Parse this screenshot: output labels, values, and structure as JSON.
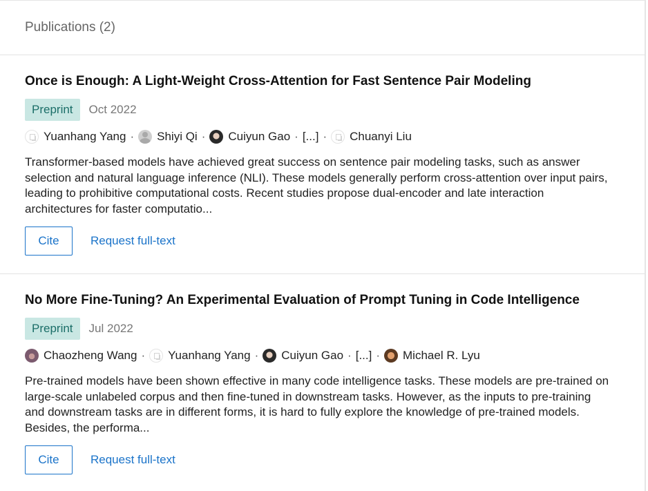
{
  "header": {
    "title": "Publications (2)"
  },
  "publications": [
    {
      "title": "Once is Enough: A Light-Weight Cross-Attention for Fast Sentence Pair Modeling",
      "type": "Preprint",
      "date": "Oct 2022",
      "authors": [
        {
          "name": "Yuanhang Yang",
          "avatar": "placeholder-avatar-icon"
        },
        {
          "name": "Shiyi Qi",
          "avatar": "generic-person-avatar-icon"
        },
        {
          "name": "Cuiyun Gao",
          "avatar": "photo-avatar"
        },
        {
          "name": "[...]"
        },
        {
          "name": "Chuanyi Liu",
          "avatar": "placeholder-avatar-icon"
        }
      ],
      "separator": "·",
      "abstract": "Transformer-based models have achieved great success on sentence pair modeling tasks, such as answer selection and natural language inference (NLI). These models generally perform cross-attention over input pairs, leading to prohibitive computational costs. Recent studies propose dual-encoder and late interaction architectures for faster computatio...",
      "cite_label": "Cite",
      "request_label": "Request full-text"
    },
    {
      "title": "No More Fine-Tuning? An Experimental Evaluation of Prompt Tuning in Code Intelligence",
      "type": "Preprint",
      "date": "Jul 2022",
      "authors": [
        {
          "name": "Chaozheng Wang",
          "avatar": "photo-avatar"
        },
        {
          "name": "Yuanhang Yang",
          "avatar": "placeholder-avatar-icon"
        },
        {
          "name": "Cuiyun Gao",
          "avatar": "photo-avatar"
        },
        {
          "name": "[...]"
        },
        {
          "name": "Michael R. Lyu",
          "avatar": "photo-avatar"
        }
      ],
      "separator": "·",
      "abstract": "Pre-trained models have been shown effective in many code intelligence tasks. These models are pre-trained on large-scale unlabeled corpus and then fine-tuned in downstream tasks. However, as the inputs to pre-training and downstream tasks are in different forms, it is hard to fully explore the knowledge of pre-trained models. Besides, the performa...",
      "cite_label": "Cite",
      "request_label": "Request full-text"
    }
  ],
  "colors": {
    "accent": "#1a73c9",
    "badge_bg": "#c9e7e3",
    "badge_text": "#1b6e68"
  }
}
